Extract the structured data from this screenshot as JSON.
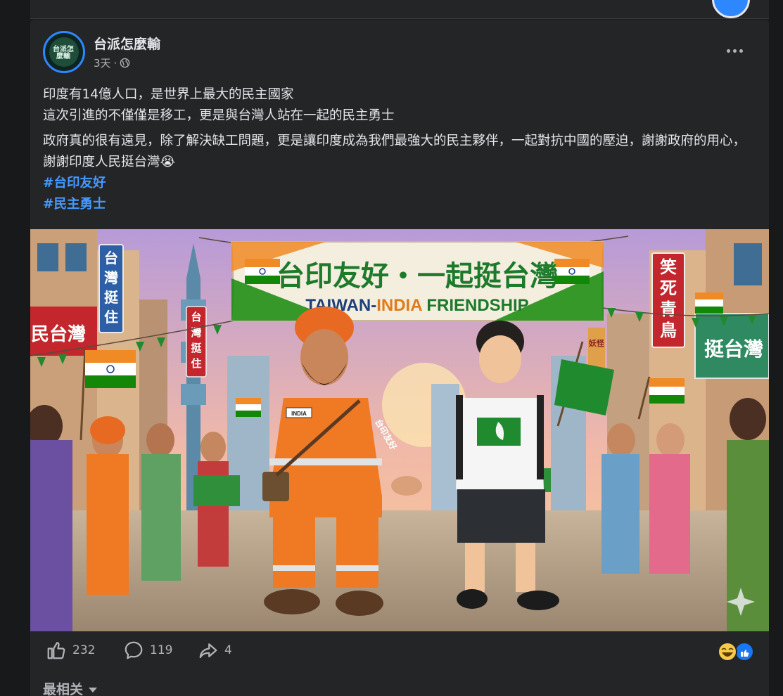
{
  "post": {
    "page_name": "台派怎麼輸",
    "time": "3天",
    "dot": "·",
    "avatar_text": "台派怎麼輸",
    "lines": [
      "印度有14億人口，是世界上最大的民主國家",
      "這次引進的不僅僅是移工，更是與台灣人站在一起的民主勇士"
    ],
    "paragraph": "政府真的很有遠見，除了解決缺工問題，更是讓印度成為我們最強大的民主夥伴，一起對抗中國的壓迫，謝謝政府的用心，謝謝印度人民挺台灣😭",
    "hashtags": [
      "#台印友好",
      "#民主勇士"
    ]
  },
  "image": {
    "banner_cn": "台印友好・一起挺台灣",
    "banner_en_1": "TAIWAN-",
    "banner_en_2": "INDIA",
    "banner_en_3": " FRIENDSHIP",
    "sign_left_1": "台",
    "sign_left_2": "灣",
    "sign_left_3": "挺",
    "sign_left_4": "住",
    "tower_sign_1": "台",
    "tower_sign_2": "灣",
    "tower_sign_3": "挺",
    "tower_sign_4": "住",
    "sign_left_red": "民台灣",
    "sign_right_1": "笑",
    "sign_right_2": "死",
    "sign_right_3": "青",
    "sign_right_4": "鳥",
    "sign_right_green": "挺台灣",
    "sign_right_small": "妖怪",
    "chest_badge": "INDIA",
    "sleeve_text": "台印友好",
    "colors": {
      "saffron": "#f08a24",
      "india_green": "#138808",
      "taiwan_green": "#1f8a2e",
      "banner_bg": "#f4eedf",
      "sky_top": "#b79ad8",
      "sky_bottom": "#f7c994"
    }
  },
  "actions": {
    "like_count": "232",
    "comment_count": "119",
    "share_count": "4"
  },
  "sort_label": "最相关"
}
